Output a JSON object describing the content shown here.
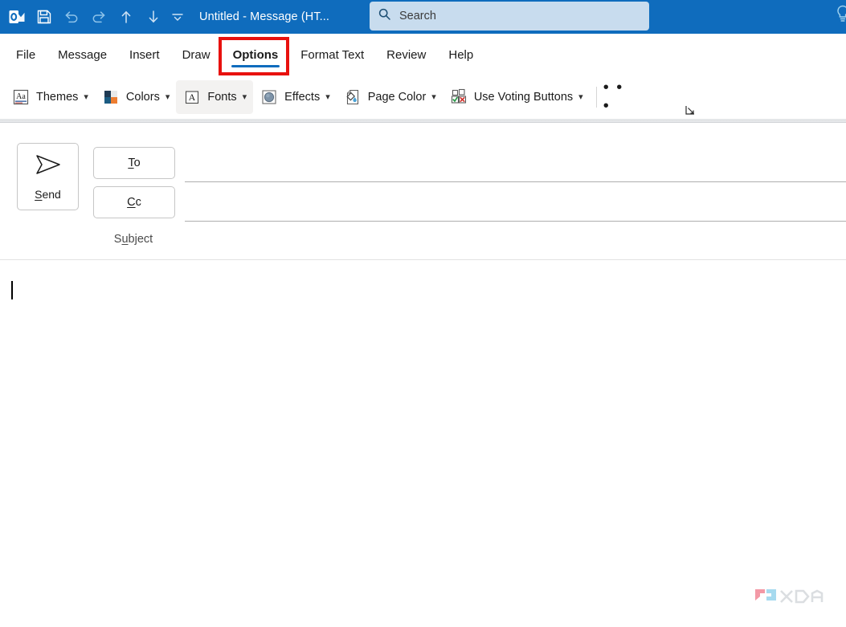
{
  "window": {
    "title": "Untitled  -  Message (HT...",
    "app_icon": "outlook-icon"
  },
  "quick_access_toolbar": {
    "items": [
      {
        "name": "save-icon",
        "label": "Save"
      },
      {
        "name": "undo-icon",
        "label": "Undo"
      },
      {
        "name": "redo-icon",
        "label": "Redo"
      },
      {
        "name": "previous-item-icon",
        "label": "Previous Item"
      },
      {
        "name": "next-item-icon",
        "label": "Next Item"
      },
      {
        "name": "customize-quick-access-toolbar-icon",
        "label": "Customize Quick Access Toolbar"
      }
    ]
  },
  "search": {
    "placeholder": "Search",
    "value": "",
    "icon": "search-icon"
  },
  "tell_me": {
    "icon": "lightbulb-icon"
  },
  "tabs": [
    {
      "label": "File",
      "active": false
    },
    {
      "label": "Message",
      "active": false
    },
    {
      "label": "Insert",
      "active": false
    },
    {
      "label": "Draw",
      "active": false
    },
    {
      "label": "Options",
      "active": true
    },
    {
      "label": "Format Text",
      "active": false
    },
    {
      "label": "Review",
      "active": false
    },
    {
      "label": "Help",
      "active": false
    }
  ],
  "annotation": {
    "target": "Options",
    "color": "#e8110e"
  },
  "ribbon": {
    "accent_color": "#0f6cbd",
    "commands": [
      {
        "label": "Themes",
        "icon": "themes-icon",
        "has_dropdown": true,
        "highlight": false
      },
      {
        "label": "Colors",
        "icon": "colors-icon",
        "has_dropdown": true,
        "highlight": false
      },
      {
        "label": "Fonts",
        "icon": "fonts-icon",
        "has_dropdown": true,
        "highlight": true
      },
      {
        "label": "Effects",
        "icon": "effects-icon",
        "has_dropdown": true,
        "highlight": false
      },
      {
        "label": "Page Color",
        "icon": "page-color-icon",
        "has_dropdown": true,
        "highlight": false
      },
      {
        "label": "Use Voting Buttons",
        "icon": "voting-buttons-icon",
        "has_dropdown": true,
        "highlight": false
      }
    ],
    "overflow_label": "• • •",
    "dialog_launcher": "dialog-box-launcher-icon"
  },
  "compose": {
    "send_label": "Send",
    "send_icon": "send-arrow-icon",
    "to_label": "To",
    "cc_label": "Cc",
    "subject_label": "Subject",
    "to_value": "",
    "cc_value": "",
    "subject_value": "",
    "body_value": ""
  },
  "watermark": {
    "text": "XDA"
  }
}
